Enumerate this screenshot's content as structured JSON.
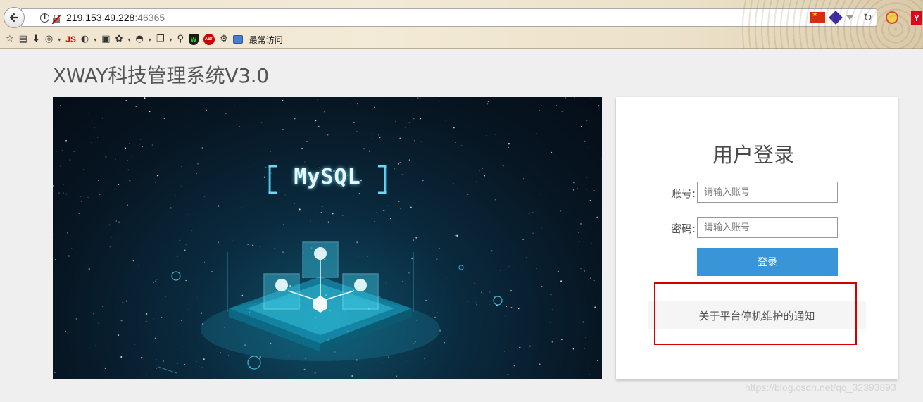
{
  "browser": {
    "url_host": "219.153.49.228",
    "url_port": ":46365",
    "bookmarks_label": "最常访问",
    "icons": [
      "back-arrow-icon",
      "info-icon",
      "insecure-lock-icon",
      "china-flag-icon",
      "gem-icon",
      "reload-icon",
      "blocked-icon",
      "yandex-icon"
    ],
    "toolbar_js": "JS",
    "toolbar_abp": "ABP",
    "y_badge": "Y"
  },
  "page": {
    "title": "XWAY科技管理系统V3.0"
  },
  "banner": {
    "text": "MySQL"
  },
  "login": {
    "title": "用户登录",
    "account_label": "账号:",
    "account_placeholder": "请输入账号",
    "password_label": "密码:",
    "password_placeholder": "请输入账号",
    "submit_label": "登录",
    "notice_link": "关于平台停机维护的通知"
  },
  "watermark": "https://blog.csdn.net/qq_32393893",
  "colors": {
    "primary_button": "#3a95d8",
    "highlight": "#d40000",
    "page_background": "#efefef"
  }
}
